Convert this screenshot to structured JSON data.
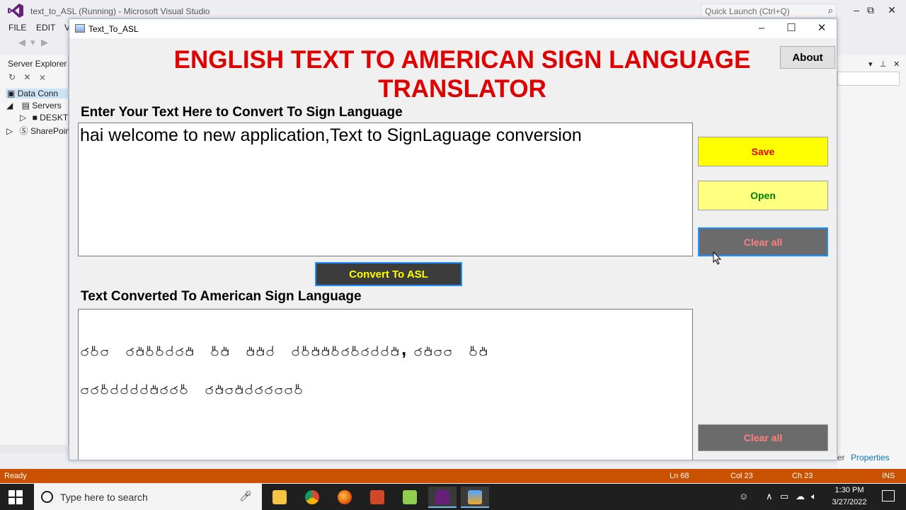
{
  "vs": {
    "window_title": "text_to_ASL (Running) - Microsoft Visual Studio",
    "quick_launch_placeholder": "Quick Launch (Ctrl+Q)",
    "menu": [
      "FILE",
      "EDIT",
      "V"
    ],
    "server_explorer": {
      "title": "Server Explorer",
      "items": [
        {
          "label": "Data Conn",
          "expander": "",
          "selected": true
        },
        {
          "label": "Servers",
          "expander": "◢"
        },
        {
          "label": "DESKT",
          "expander": "▷"
        },
        {
          "label": "SharePoin",
          "expander": "▷"
        }
      ]
    },
    "bottom_tabs": {
      "prev": "er",
      "properties": "Properties"
    },
    "status": {
      "ready": "Ready",
      "ln": "Ln 68",
      "col": "Col 23",
      "ch": "Ch 23",
      "mode": "INS"
    },
    "accent_color": "#ca5100"
  },
  "app": {
    "title": "Text_To_ASL",
    "heading": "ENGLISH TEXT TO AMERICAN SIGN LANGUAGE TRANSLATOR",
    "about_label": "About",
    "input_label": "Enter Your Text Here to Convert To Sign Language",
    "input_text": "hai welcome to new application,Text to SignLaguage conversion",
    "convert_label": "Convert To ASL",
    "output_label": "Text Converted To American Sign Language",
    "save_label": "Save",
    "open_label": "Open",
    "clear_input_label": "Clear all",
    "clear_output_label": "Clear all",
    "output_font": "American Sign Language fingerspelling glyphs"
  },
  "taskbar": {
    "search_placeholder": "Type here to search",
    "apps": [
      "file-explorer",
      "chrome",
      "firefox",
      "powerpoint",
      "notepad-plus",
      "visual-studio",
      "text-to-asl-app"
    ],
    "time": "1:30 PM",
    "date": "3/27/2022"
  }
}
